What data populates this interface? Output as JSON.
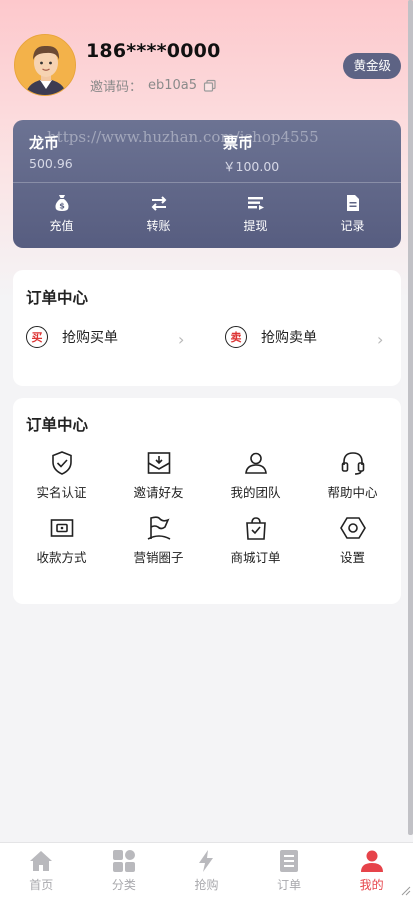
{
  "user": {
    "phone": "186****0000",
    "invite_label": "邀请码：",
    "invite_code": "eb10a5",
    "level": "黄金级"
  },
  "wallet": {
    "watermark": "https://www.huzhan.com/ishop4555",
    "balances": [
      {
        "name": "龙币",
        "value": "500.96"
      },
      {
        "name": "票币",
        "value": "￥100.00"
      }
    ],
    "actions": [
      {
        "label": "充值",
        "icon": "money-bag-icon"
      },
      {
        "label": "转账",
        "icon": "transfer-arrows-icon"
      },
      {
        "label": "提现",
        "icon": "withdraw-icon"
      },
      {
        "label": "记录",
        "icon": "document-icon"
      }
    ]
  },
  "order_center": {
    "title": "订单中心",
    "rows": [
      {
        "tag": "买",
        "label": "抢购买单"
      },
      {
        "tag": "卖",
        "label": "抢购卖单"
      }
    ]
  },
  "service_center": {
    "title": "订单中心",
    "items": [
      {
        "label": "实名认证",
        "icon": "shield-check-icon"
      },
      {
        "label": "邀请好友",
        "icon": "invite-envelope-icon"
      },
      {
        "label": "我的团队",
        "icon": "person-icon"
      },
      {
        "label": "帮助中心",
        "icon": "headset-icon"
      },
      {
        "label": "收款方式",
        "icon": "wallet-icon"
      },
      {
        "label": "营销圈子",
        "icon": "flag-icon"
      },
      {
        "label": "商城订单",
        "icon": "shopping-bag-icon"
      },
      {
        "label": "设置",
        "icon": "settings-hexagon-icon"
      }
    ]
  },
  "tabbar": {
    "active_color": "#e6434a",
    "items": [
      {
        "label": "首页",
        "icon": "home-icon"
      },
      {
        "label": "分类",
        "icon": "category-grid-icon"
      },
      {
        "label": "抢购",
        "icon": "lightning-icon"
      },
      {
        "label": "订单",
        "icon": "order-list-icon"
      },
      {
        "label": "我的",
        "icon": "user-icon",
        "active": true
      }
    ]
  }
}
